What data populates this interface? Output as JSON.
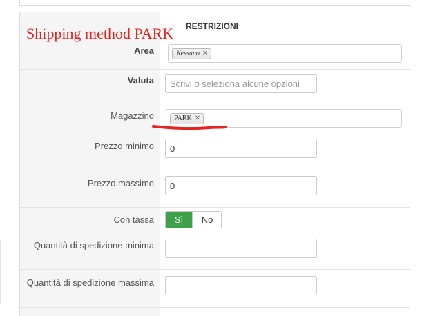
{
  "header": {
    "title": "RESTRIZIONI"
  },
  "annotation": {
    "text": "Shipping method PARK",
    "color": "#e8231f"
  },
  "fields": {
    "area": {
      "label": "Area",
      "chip": "Nessuno",
      "chip_remove": "✕"
    },
    "valuta": {
      "label": "Valuta",
      "placeholder": "Scrivi o seleziona alcune opzioni"
    },
    "magazzino": {
      "label": "Magazzino",
      "chip": "PARK",
      "chip_remove": "✕"
    },
    "prezzo_minimo": {
      "label": "Prezzo minimo",
      "value": "0"
    },
    "prezzo_massimo": {
      "label": "Prezzo massimo",
      "value": "0"
    },
    "con_tassa": {
      "label": "Con tassa",
      "yes": "Sì",
      "no": "No",
      "selected": "Sì",
      "active_color": "#3ea14a"
    },
    "qta_min": {
      "label": "Quantità di spedizione minima",
      "value": ""
    },
    "qta_max": {
      "label": "Quantità di spedizione massima",
      "value": ""
    }
  },
  "icons": {
    "chip_remove": "close-icon"
  }
}
